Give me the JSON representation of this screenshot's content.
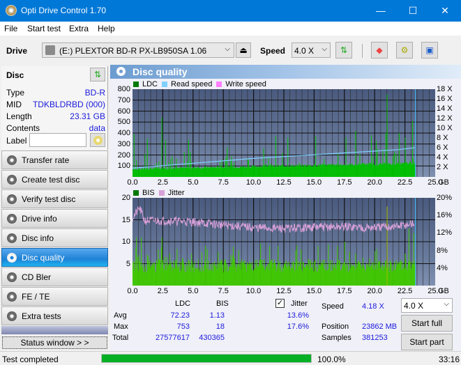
{
  "window": {
    "title": "Opti Drive Control 1.70",
    "minimize": "—",
    "maximize": "☐",
    "close": "✕"
  },
  "menu": [
    "File",
    "Start test",
    "Extra",
    "Help"
  ],
  "toolbar": {
    "drive_label": "Drive",
    "drive_value": "(E:)  PLEXTOR BD-R  PX-LB950SA 1.06",
    "speed_label": "Speed",
    "speed_value": "4.0 X"
  },
  "disc": {
    "header": "Disc",
    "rows": [
      {
        "label": "Type",
        "value": "BD-R"
      },
      {
        "label": "MID",
        "value": "TDKBLDRBD (000)"
      },
      {
        "label": "Length",
        "value": "23.31 GB"
      },
      {
        "label": "Contents",
        "value": "data"
      }
    ],
    "label_field": "Label",
    "label_value": ""
  },
  "nav": [
    "Transfer rate",
    "Create test disc",
    "Verify test disc",
    "Drive info",
    "Disc info",
    "Disc quality",
    "CD Bler",
    "FE / TE",
    "Extra tests"
  ],
  "nav_active": "Disc quality",
  "status_window": "Status window > >",
  "panel_title": "Disc quality",
  "chart_data": [
    {
      "type": "bar",
      "title": "LDC",
      "legend": [
        "LDC",
        "Read speed",
        "Write speed"
      ],
      "colors": {
        "LDC": "#00c000",
        "Read speed": "#80d0ff",
        "Write speed": "#ff80ff"
      },
      "xlabel": "GB",
      "x_ticks": [
        "0.0",
        "2.5",
        "5.0",
        "7.5",
        "10.0",
        "12.5",
        "15.0",
        "17.5",
        "20.0",
        "22.5",
        "25.0"
      ],
      "y_ticks_left": [
        "100",
        "200",
        "300",
        "400",
        "500",
        "600",
        "700",
        "800"
      ],
      "y_ticks_right": [
        "2 X",
        "4 X",
        "6 X",
        "8 X",
        "10 X",
        "12 X",
        "14 X",
        "16 X",
        "18 X"
      ],
      "xlim": [
        0,
        25
      ],
      "ylim": [
        0,
        800
      ],
      "y2lim": [
        0,
        18
      ],
      "ldc_peaks": [
        [
          0.1,
          390
        ],
        [
          1.2,
          350
        ],
        [
          2.4,
          540
        ],
        [
          2.7,
          340
        ],
        [
          4.6,
          340
        ],
        [
          7.8,
          270
        ],
        [
          10.8,
          260
        ],
        [
          11.8,
          370
        ],
        [
          12.8,
          360
        ],
        [
          15.1,
          370
        ],
        [
          17.6,
          360
        ],
        [
          18.4,
          420
        ],
        [
          19.7,
          380
        ],
        [
          20.1,
          330
        ],
        [
          20.9,
          400
        ],
        [
          21.0,
          753
        ],
        [
          22.0,
          400
        ],
        [
          22.5,
          360
        ],
        [
          23.1,
          510
        ]
      ],
      "read_speed": [
        [
          0,
          1.8
        ],
        [
          1,
          2.0
        ],
        [
          2.5,
          2.3
        ],
        [
          4,
          2.6
        ],
        [
          5.5,
          2.9
        ],
        [
          7,
          3.2
        ],
        [
          8.5,
          3.5
        ],
        [
          10,
          3.8
        ],
        [
          12,
          4.1
        ],
        [
          14,
          4.4
        ],
        [
          16,
          4.7
        ],
        [
          18,
          5.0
        ],
        [
          20,
          5.3
        ],
        [
          22,
          5.6
        ],
        [
          23.3,
          6.0
        ]
      ]
    },
    {
      "type": "bar",
      "title": "BIS",
      "legend": [
        "BIS",
        "Jitter"
      ],
      "colors": {
        "BIS": "#40c800",
        "Jitter": "#d8a0d8"
      },
      "xlabel": "GB",
      "x_ticks": [
        "0.0",
        "2.5",
        "5.0",
        "7.5",
        "10.0",
        "12.5",
        "15.0",
        "17.5",
        "20.0",
        "22.5",
        "25.0"
      ],
      "y_ticks_left": [
        "5",
        "10",
        "15",
        "20"
      ],
      "y_ticks_right": [
        "4%",
        "8%",
        "12%",
        "16%",
        "20%"
      ],
      "xlim": [
        0,
        25
      ],
      "ylim": [
        0,
        20
      ],
      "y2lim": [
        0,
        20
      ],
      "bis_peaks": [
        [
          0.3,
          11
        ],
        [
          0.7,
          11
        ],
        [
          2.4,
          11
        ],
        [
          12.0,
          9
        ],
        [
          17.5,
          10
        ],
        [
          21.0,
          18
        ],
        [
          22.8,
          13
        ],
        [
          23.2,
          12
        ]
      ],
      "jitter": [
        [
          0,
          15.5
        ],
        [
          0.6,
          17.6
        ],
        [
          1,
          14.8
        ],
        [
          3,
          14.8
        ],
        [
          5,
          14.5
        ],
        [
          7.5,
          13.8
        ],
        [
          10,
          13.2
        ],
        [
          12.5,
          13.0
        ],
        [
          15,
          13.3
        ],
        [
          17.5,
          13.4
        ],
        [
          20,
          13.2
        ],
        [
          22,
          13.5
        ],
        [
          23.3,
          14.2
        ]
      ]
    }
  ],
  "stats": {
    "headers": [
      "LDC",
      "BIS"
    ],
    "avg_label": "Avg",
    "avg": [
      "72.23",
      "1.13"
    ],
    "max_label": "Max",
    "max": [
      "753",
      "18"
    ],
    "total_label": "Total",
    "total": [
      "27577617",
      "430365"
    ],
    "jitter_label": "Jitter",
    "jitter_checked": true,
    "jitter_avg": "13.6%",
    "jitter_max": "17.6%",
    "speed_label": "Speed",
    "speed_value": "4.18 X",
    "position_label": "Position",
    "position_value": "23862 MB",
    "samples_label": "Samples",
    "samples_value": "381253",
    "speed_select": "4.0 X",
    "start_full": "Start full",
    "start_part": "Start part"
  },
  "statusbar": {
    "text": "Test completed",
    "progress": 100.0,
    "progress_text": "100.0%",
    "time": "33:16"
  }
}
